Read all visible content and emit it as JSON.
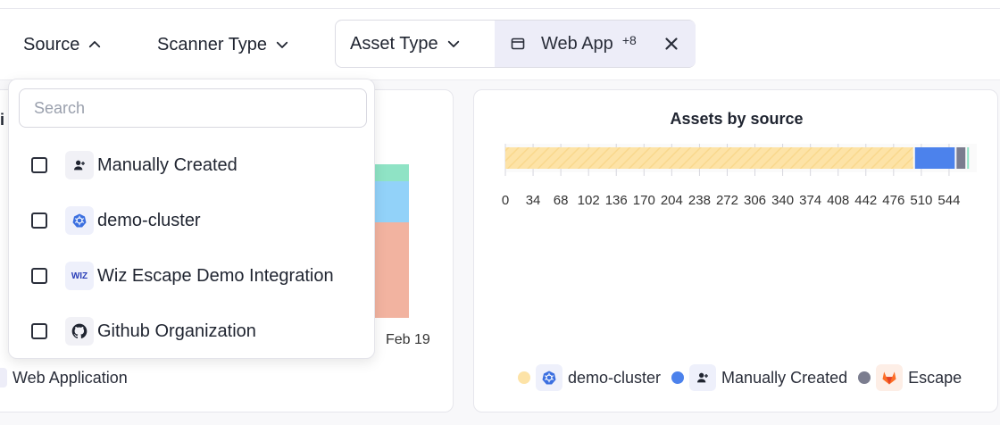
{
  "filters": {
    "source_label": "Source",
    "scanner_type_label": "Scanner Type",
    "asset_type_label": "Asset Type",
    "chip_label": "Web App",
    "chip_count": "+8"
  },
  "dropdown": {
    "search_placeholder": "Search",
    "options": [
      {
        "label": "Manually Created",
        "icon": "user-icon"
      },
      {
        "label": "demo-cluster",
        "icon": "kubernetes-icon"
      },
      {
        "label": "Wiz Escape Demo Integration",
        "icon": "wiz-icon"
      },
      {
        "label": "Github Organization",
        "icon": "github-icon"
      }
    ],
    "wiz_icon_text": "WIZ"
  },
  "left_card": {
    "truncated_title": "i",
    "date_label": "Feb 19",
    "legend_label": "Web Application",
    "stack_colors": [
      "#8fe3c5",
      "#92d2f9",
      "#f2b3a0"
    ],
    "stack_fractions": [
      0.11,
      0.27,
      0.62
    ]
  },
  "chart_data": {
    "type": "bar",
    "orientation": "horizontal",
    "title": "Assets by source",
    "categories": [
      "demo-cluster",
      "Manually Created",
      "Escape"
    ],
    "series": [
      {
        "name": "demo-cluster",
        "values": [
          500
        ],
        "color": "#fde3a7"
      },
      {
        "name": "Manually Created",
        "values": [
          51
        ],
        "color": "#4c82ec"
      },
      {
        "name": "Escape",
        "values": [
          13
        ],
        "color": "#7b7d8f"
      },
      {
        "values": [
          3
        ],
        "color": "#8fe3c5"
      }
    ],
    "xlim": [
      0,
      578
    ],
    "x_ticks": [
      0,
      34,
      68,
      102,
      136,
      170,
      204,
      238,
      272,
      306,
      340,
      374,
      408,
      442,
      476,
      510,
      544
    ],
    "grid": true,
    "legend_position": "bottom"
  },
  "legend": {
    "items": [
      {
        "label": "demo-cluster",
        "color": "#fde3a7",
        "icon": "kubernetes-icon"
      },
      {
        "label": "Manually Created",
        "color": "#4c82ec",
        "icon": "user-icon"
      },
      {
        "label": "Escape",
        "color": "#7b7d8f",
        "icon": "gitlab-icon"
      }
    ]
  },
  "colors": {
    "accent": "#5b6ee1",
    "chip_bg": "#ededf8"
  }
}
